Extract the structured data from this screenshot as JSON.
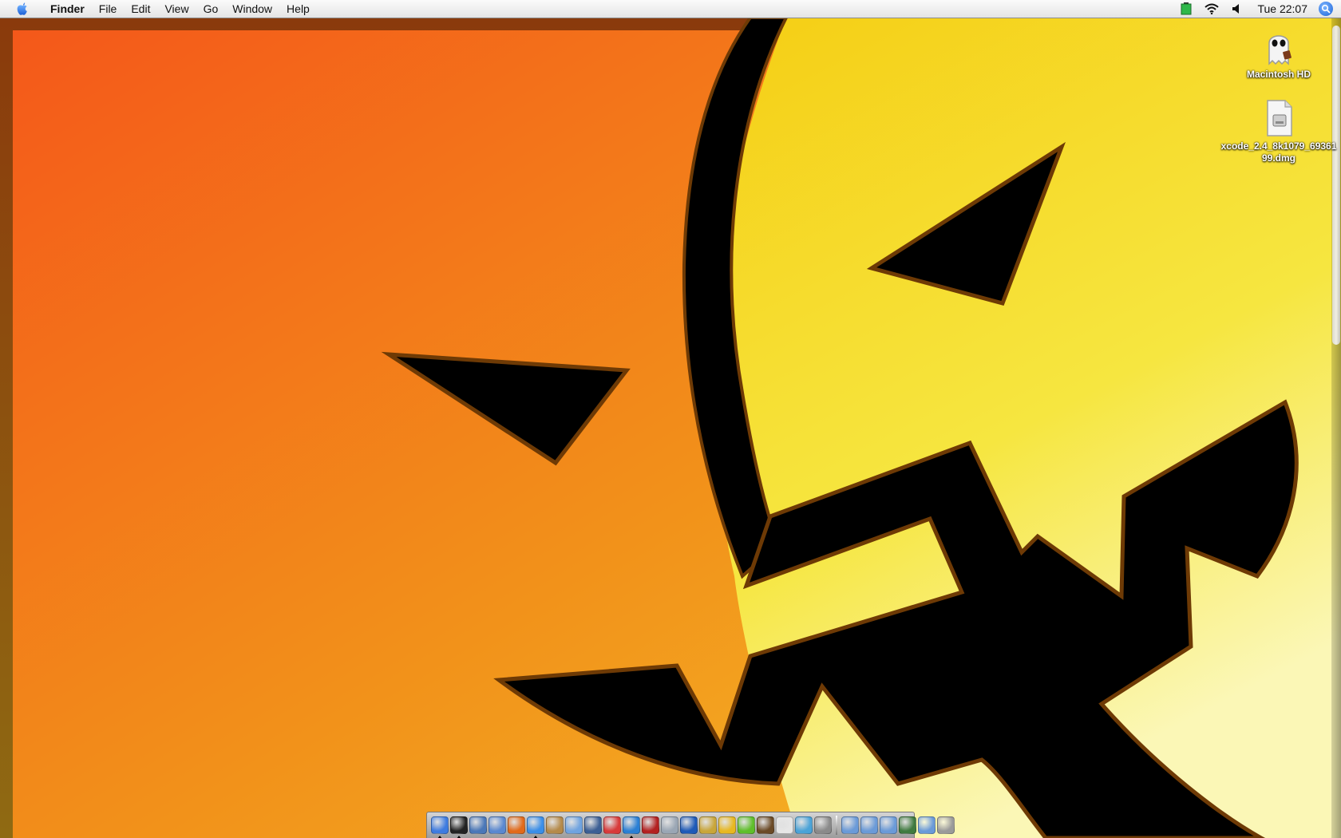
{
  "menubar": {
    "apple_icon": "apple-icon",
    "app_name": "Finder",
    "menus": [
      "File",
      "Edit",
      "View",
      "Go",
      "Window",
      "Help"
    ],
    "clock": "Tue 22:07",
    "status_icons": [
      "battery-icon",
      "wifi-icon",
      "volume-icon",
      "spotlight-icon"
    ]
  },
  "desktop": {
    "wallpaper": "jack-o-lantern",
    "colors": {
      "orange": "#f4581a",
      "yellow": "#f7d21f",
      "black": "#000000",
      "outline": "#6e3a05"
    },
    "icons": [
      {
        "label": "Macintosh HD",
        "icon": "ghost-drive-icon"
      },
      {
        "label": "xcode_2.4_8k1079_6936199.dmg",
        "icon": "disk-image-icon"
      }
    ]
  },
  "dock": {
    "apps": [
      {
        "icon": "finder-icon",
        "color": "#3d7be0",
        "running": true
      },
      {
        "icon": "dashboard-icon",
        "color": "#222222",
        "running": true
      },
      {
        "icon": "preview-icon",
        "color": "#4a77b8",
        "running": false
      },
      {
        "icon": "network-icon",
        "color": "#5a88d0",
        "running": false
      },
      {
        "icon": "firefox-icon",
        "color": "#e26a1a",
        "running": false
      },
      {
        "icon": "safari-icon",
        "color": "#3a8ee8",
        "running": true
      },
      {
        "icon": "address-book-icon",
        "color": "#b58a4a",
        "running": false
      },
      {
        "icon": "itunes-icon",
        "color": "#6fa3e0",
        "running": false
      },
      {
        "icon": "iphoto-icon",
        "color": "#3c5f94",
        "running": false
      },
      {
        "icon": "ical-icon",
        "color": "#d83a3a",
        "running": false
      },
      {
        "icon": "world-icon",
        "color": "#2a7fd4",
        "running": true
      },
      {
        "icon": "book-icon",
        "color": "#b32020",
        "running": false
      },
      {
        "icon": "mail-icon",
        "color": "#9aa6b4",
        "running": false
      },
      {
        "icon": "word-icon",
        "color": "#1e5ab8",
        "running": false
      },
      {
        "icon": "user-icon",
        "color": "#c9a63a",
        "running": false
      },
      {
        "icon": "aim-icon",
        "color": "#e8b820",
        "running": false
      },
      {
        "icon": "limewire-icon",
        "color": "#5fbf2a",
        "running": false
      },
      {
        "icon": "chess-icon",
        "color": "#6b4a26",
        "running": false
      },
      {
        "icon": "textedit-icon",
        "color": "#e6e6e6",
        "running": false
      },
      {
        "icon": "network-utility-icon",
        "color": "#4aa3d8",
        "running": false
      },
      {
        "icon": "calculator-icon",
        "color": "#8a8a8a",
        "running": false
      }
    ],
    "stacks": [
      {
        "icon": "applications-folder-icon",
        "color": "#6a9ad8"
      },
      {
        "icon": "downloads-folder-icon",
        "color": "#6a9ad8"
      },
      {
        "icon": "documents-folder-icon",
        "color": "#6a9ad8"
      },
      {
        "icon": "desktop-folder-icon",
        "color": "#3f7a3f"
      },
      {
        "icon": "folder-icon",
        "color": "#6a9ad8"
      },
      {
        "icon": "trash-icon",
        "color": "#9a9a9a"
      }
    ]
  }
}
